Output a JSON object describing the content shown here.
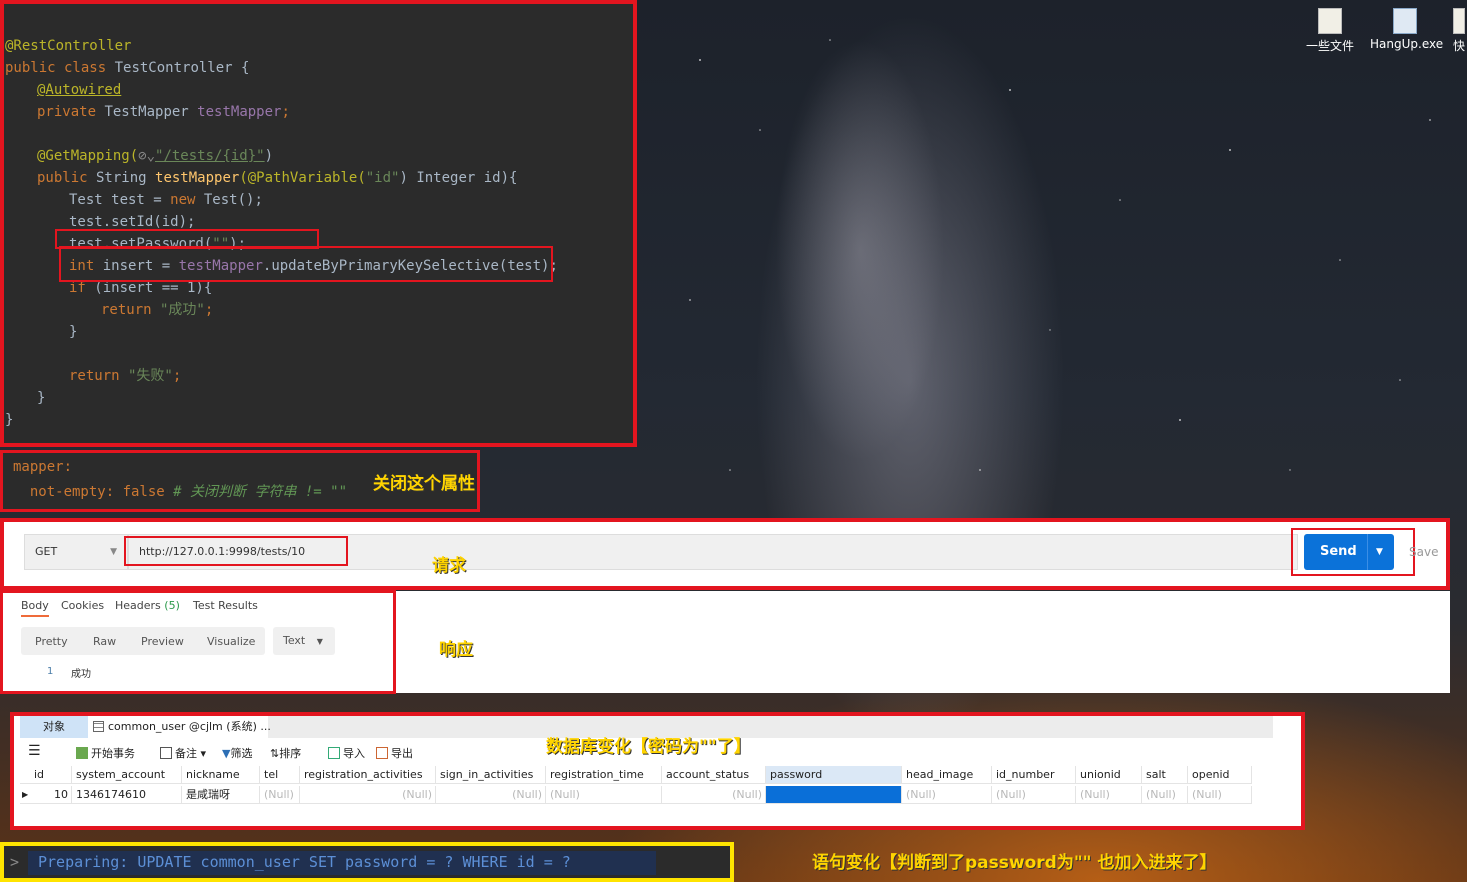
{
  "desktop": {
    "icons": [
      {
        "label": "一些文件",
        "icon": "document-icon"
      },
      {
        "label": "HangUp.exe",
        "icon": "exe-icon"
      },
      {
        "label": "快",
        "icon": "shortcut-icon"
      }
    ]
  },
  "code": {
    "lines": {
      "l1": "@RestController",
      "l2_kw": "public class",
      "l2_rest": " TestController {",
      "l3": "@Autowired",
      "l4_kw": "private",
      "l4_type": " TestMapper ",
      "l4_field": "testMapper",
      "l4_end": ";",
      "l6_ann": "@GetMapping(",
      "l6_icon": "⊘⌄",
      "l6_str": "\"/tests/{id}\"",
      "l6_end": ")",
      "l7_kw": "public",
      "l7_type": " String ",
      "l7_fn": "testMapper",
      "l7_ann": "(@PathVariable(",
      "l7_str": "\"id\"",
      "l7_rest": ") Integer id){",
      "l8_a": "Test test = ",
      "l8_kw": "new",
      "l8_b": " Test();",
      "l9": "test.setId(id);",
      "l10_a": "test.setPassword(",
      "l10_str": "\"\"",
      "l10_b": ");",
      "l11_kw": "int",
      "l11_a": " insert = ",
      "l11_field": "testMapper",
      "l11_b": ".updateByPrimaryKeySelective(test);",
      "l12_kw": "if",
      "l12_rest": " (insert == 1){",
      "l13_kw": "return",
      "l13_str": " \"成功\"",
      "l13_end": ";",
      "l14": "}",
      "l16_kw": "return",
      "l16_str": " \"失败\"",
      "l16_end": ";",
      "l17": "}",
      "l18": "}"
    }
  },
  "yaml": {
    "line1": "mapper:",
    "line2_key": "  not-empty: ",
    "line2_val": "false",
    "line2_comment": " # 关闭判断 字符串 != \"\""
  },
  "labels": {
    "close_property": "关闭这个属性",
    "request": "请求",
    "response": "响应",
    "db_change": "数据库变化【密码为\"\"了】",
    "sql_change": "语句变化【判断到了password为\"\" 也加入进来了】"
  },
  "request": {
    "method": "GET",
    "url": "http://127.0.0.1:9998/tests/10",
    "send_label": "Send",
    "save_label": "Save"
  },
  "response": {
    "tabs": [
      "Body",
      "Cookies",
      "Headers",
      "Test Results"
    ],
    "headers_count": "(5)",
    "view_modes": [
      "Pretty",
      "Raw",
      "Preview",
      "Visualize"
    ],
    "format": "Text",
    "line_no": "1",
    "body": "成功"
  },
  "db": {
    "tab_objects": "对象",
    "tab_table": "common_user @cjlm (系统) ...",
    "toolbar": {
      "begin_tx": "开始事务",
      "note": "备注",
      "filter": "筛选",
      "sort": "排序",
      "import": "导入",
      "export": "导出"
    },
    "columns": [
      "id",
      "system_account",
      "nickname",
      "tel",
      "registration_activities",
      "sign_in_activities",
      "registration_time",
      "account_status",
      "password",
      "head_image",
      "id_number",
      "unionid",
      "salt",
      "openid"
    ],
    "row": [
      "10",
      "1346174610",
      "是咸瑞呀",
      "(Null)",
      "(Null)",
      "(Null)",
      "(Null)",
      "(Null)",
      "",
      "(Null)",
      "(Null)",
      "(Null)",
      "(Null)",
      "(Null)"
    ],
    "selected_column": "password"
  },
  "console": {
    "prompt": ">",
    "text": "Preparing: UPDATE common_user SET password = ? WHERE id = ?"
  },
  "colors": {
    "annotation_red": "#e3151f",
    "label_yellow": "#ffd400",
    "send_blue": "#0b72d9"
  }
}
